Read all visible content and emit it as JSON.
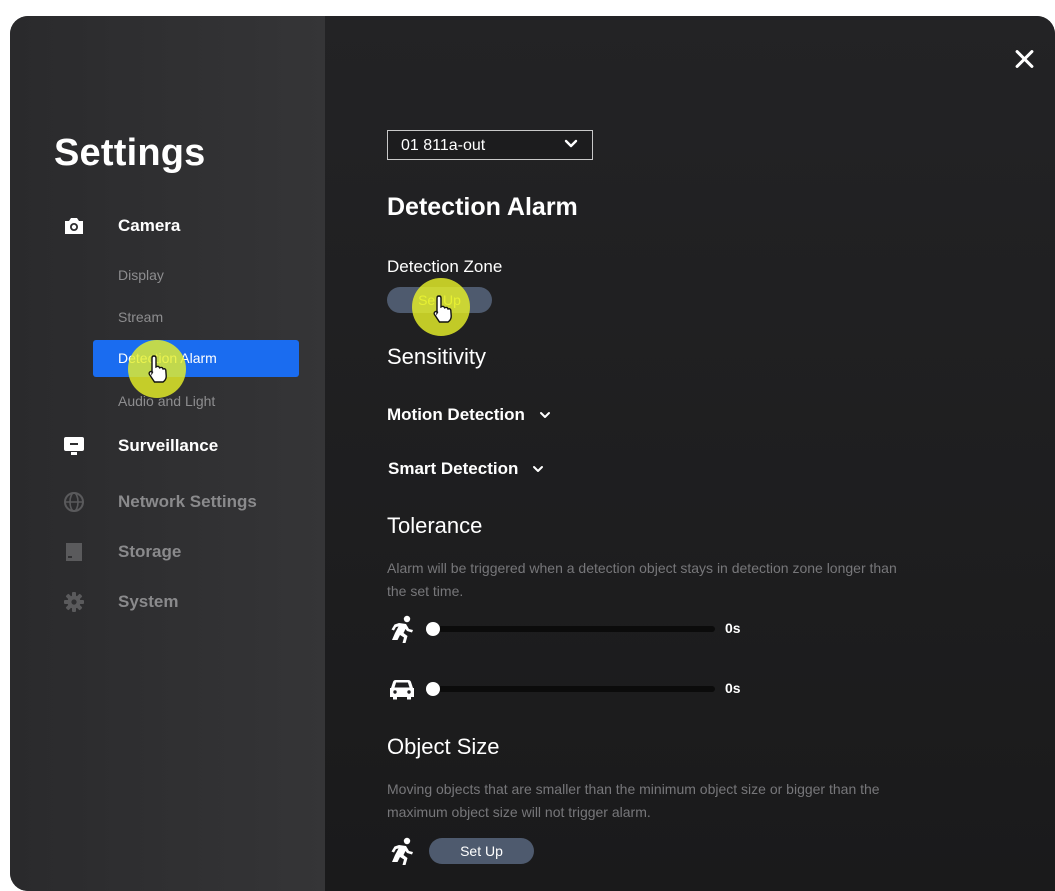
{
  "window": {
    "close_icon": "close-icon"
  },
  "sidebar": {
    "title": "Settings",
    "sections": {
      "camera": {
        "label": "Camera",
        "icon": "camera-icon",
        "items": [
          "Display",
          "Stream",
          "Detection Alarm",
          "Audio and Light"
        ],
        "active_item": "Detection Alarm"
      },
      "surveillance": {
        "label": "Surveillance",
        "icon": "monitor-icon"
      },
      "network": {
        "label": "Network Settings",
        "icon": "globe-icon"
      },
      "storage": {
        "label": "Storage",
        "icon": "storage-icon"
      },
      "system": {
        "label": "System",
        "icon": "gear-icon"
      }
    }
  },
  "main": {
    "device_select": {
      "value": "01  811a-out"
    },
    "title": "Detection Alarm",
    "detection_zone": {
      "label": "Detection Zone",
      "button": "Set Up"
    },
    "sensitivity": {
      "title": "Sensitivity",
      "motion_detection": "Motion Detection",
      "smart_detection": "Smart Detection"
    },
    "tolerance": {
      "title": "Tolerance",
      "description": "Alarm will be triggered when a detection object stays in detection zone longer than the set time.",
      "person": {
        "icon": "running-person-icon",
        "value": 0,
        "value_label": "0s"
      },
      "vehicle": {
        "icon": "car-icon",
        "value": 0,
        "value_label": "0s"
      }
    },
    "object_size": {
      "title": "Object Size",
      "description": "Moving objects that are smaller than the minimum object size or bigger than the maximum object size will not trigger alarm.",
      "person_icon": "running-person-icon",
      "button": "Set Up"
    }
  },
  "colors": {
    "accent": "#1a6cf0",
    "sidebar_bg": "#2f2f31",
    "main_bg": "#1f1f21",
    "pill_bg": "#4e5a6e",
    "cursor_highlight": "#e6f028"
  }
}
